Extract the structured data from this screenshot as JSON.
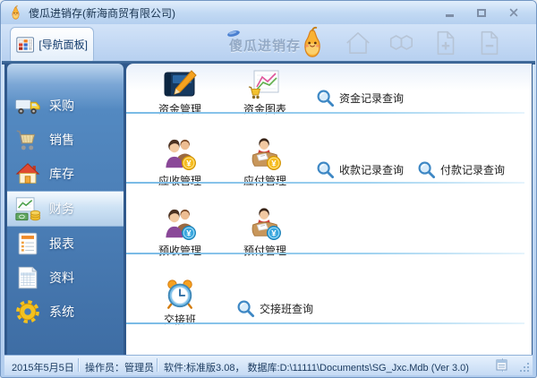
{
  "window": {
    "title": "傻瓜进销存(新海商贸有限公司)"
  },
  "toolbar": {
    "nav_button_label": "[导航面板]",
    "brand_text": "傻瓜进销存"
  },
  "sidebar": {
    "items": [
      {
        "label": "采购",
        "icon": "truck-icon",
        "selected": false
      },
      {
        "label": "销售",
        "icon": "cart-icon",
        "selected": false
      },
      {
        "label": "库存",
        "icon": "house-icon",
        "selected": false
      },
      {
        "label": "财务",
        "icon": "finance-icon",
        "selected": true
      },
      {
        "label": "报表",
        "icon": "report-icon",
        "selected": false
      },
      {
        "label": "资料",
        "icon": "data-sheet-icon",
        "selected": false
      },
      {
        "label": "系统",
        "icon": "gear-icon",
        "selected": false
      }
    ]
  },
  "main": {
    "rows": [
      {
        "modules": [
          {
            "label": "资金管理",
            "icon": "funds-management-icon"
          },
          {
            "label": "资金图表",
            "icon": "funds-chart-icon"
          }
        ],
        "queries": [
          {
            "label": "资金记录查询",
            "icon": "magnifier-icon"
          }
        ]
      },
      {
        "modules": [
          {
            "label": "应收管理",
            "icon": "receivable-icon"
          },
          {
            "label": "应付管理",
            "icon": "payable-icon"
          }
        ],
        "queries": [
          {
            "label": "收款记录查询",
            "icon": "magnifier-icon"
          },
          {
            "label": "付款记录查询",
            "icon": "magnifier-icon"
          }
        ]
      },
      {
        "modules": [
          {
            "label": "预收管理",
            "icon": "advance-receipt-icon"
          },
          {
            "label": "预付管理",
            "icon": "advance-payment-icon"
          }
        ],
        "queries": []
      },
      {
        "modules": [
          {
            "label": "交接班",
            "icon": "alarm-clock-icon"
          }
        ],
        "queries": [
          {
            "label": "交接班查询",
            "icon": "magnifier-icon"
          }
        ]
      }
    ]
  },
  "statusbar": {
    "date": "2015年5月5日",
    "operator": "操作员：管理员",
    "software": "软件:标准版3.08，  数据库:D:\\11111\\Documents\\SG_Jxc.Mdb (Ver 3.0)"
  },
  "icons": {
    "app_icon": "pear-mascot",
    "nav_button": "grid-panel",
    "toolbar_right": [
      "home",
      "books",
      "doc-plus",
      "doc-minus"
    ],
    "query_icon": "magnifier",
    "coin_gold": "#f5bb1d",
    "coin_blue": "#38a6de"
  },
  "colors": {
    "sidebar_blue": "#4a7db5",
    "frame_dark_blue": "#30598c",
    "separator_blue": "#8cc6ee",
    "toolbar_blue": "#c2d9f4"
  }
}
